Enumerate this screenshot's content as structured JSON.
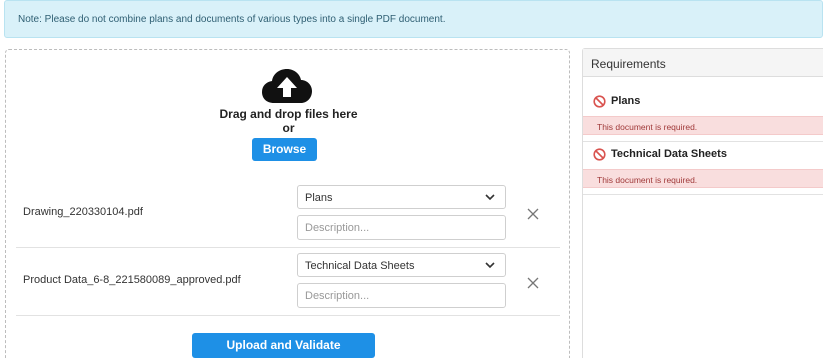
{
  "note": {
    "text": "Note: Please do not combine plans and documents of various types into a single PDF document."
  },
  "upload": {
    "drag_text": "Drag and drop files here",
    "or_text": "or",
    "browse_label": "Browse",
    "icon": "cloud-upload-icon",
    "files": [
      {
        "name": "Drawing_220330104.pdf",
        "type_selected": "Plans",
        "description_placeholder": "Description..."
      },
      {
        "name": "Product Data_6-8_221580089_approved.pdf",
        "type_selected": "Technical Data Sheets",
        "description_placeholder": "Description..."
      }
    ],
    "upload_button_label": "Upload and Validate",
    "accent_color": "#1e90e6"
  },
  "requirements": {
    "title": "Requirements",
    "items": [
      {
        "label": "Plans",
        "status_icon": "prohibited-icon",
        "error": "This document is required."
      },
      {
        "label": "Technical Data Sheets",
        "status_icon": "prohibited-icon",
        "error": "This document is required."
      }
    ],
    "error_color": "#d9534f"
  }
}
